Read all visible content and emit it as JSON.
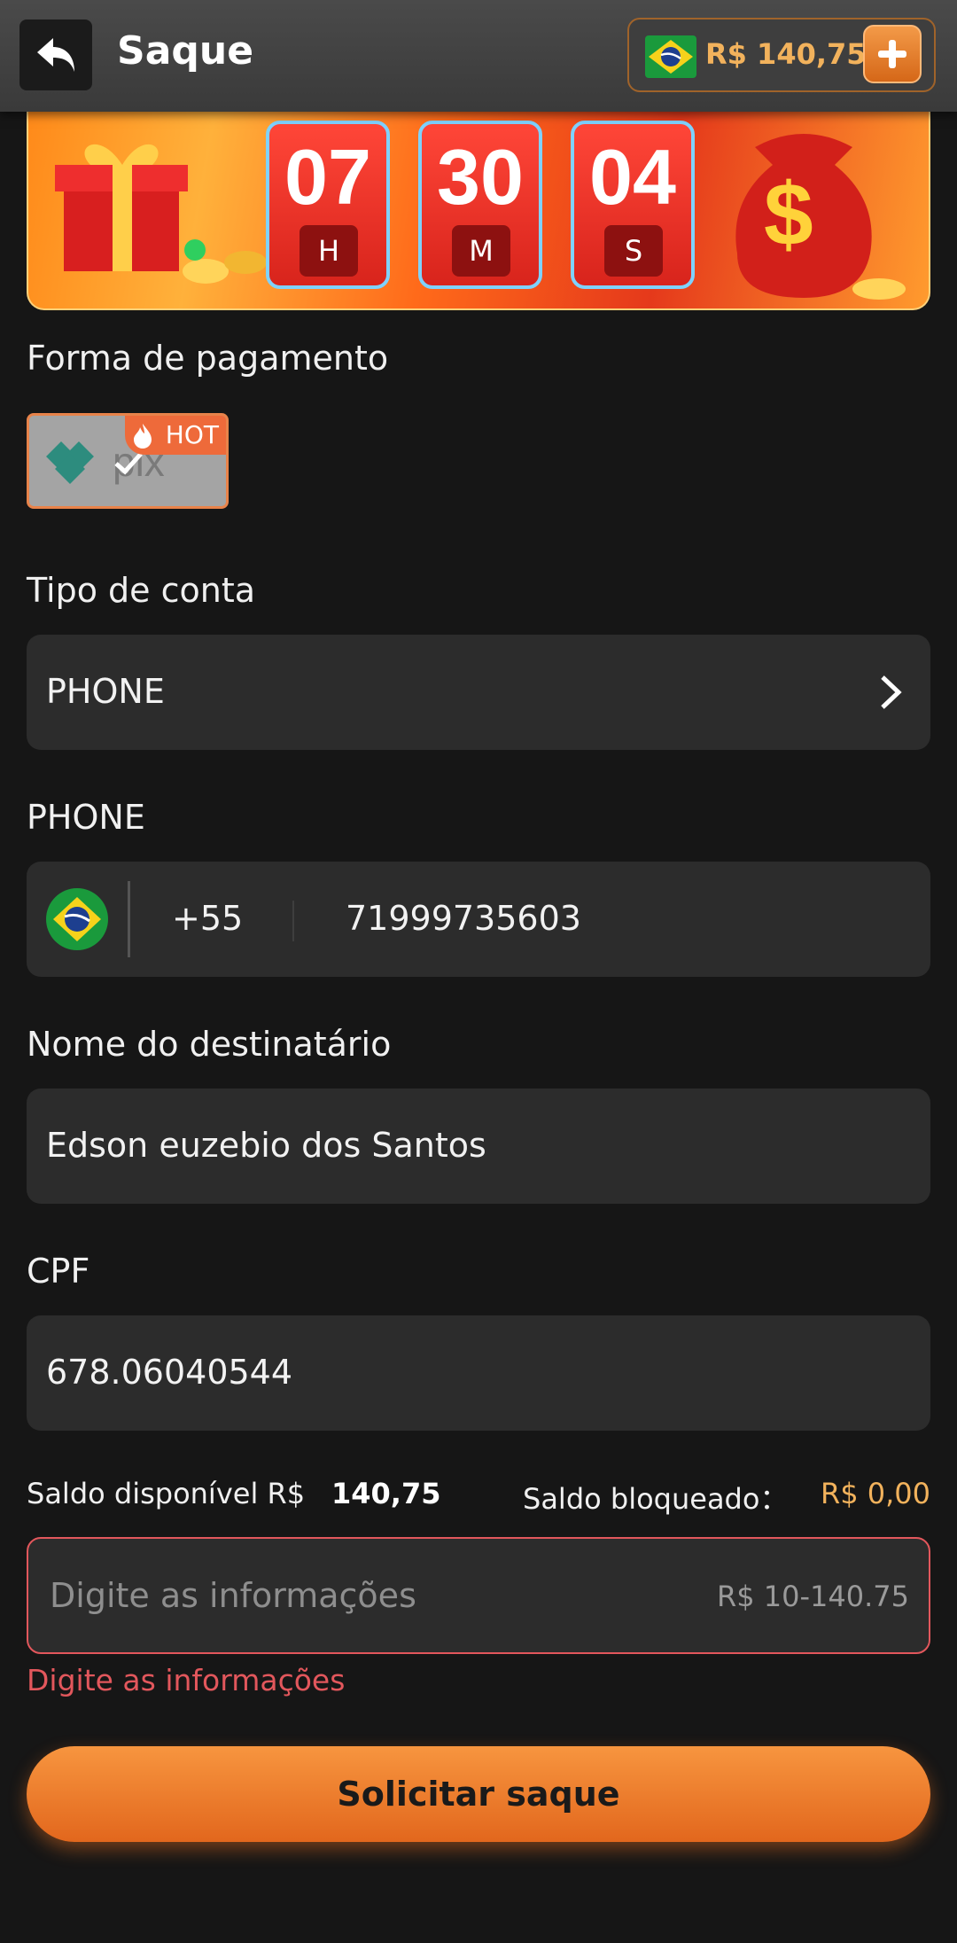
{
  "header": {
    "title": "Saque",
    "balance": "R$ 140,75"
  },
  "timer": {
    "hours": "07",
    "hours_unit": "H",
    "minutes": "30",
    "minutes_unit": "M",
    "seconds": "04",
    "seconds_unit": "S"
  },
  "payment": {
    "label": "Forma de pagamento",
    "method_badge": "HOT",
    "method_name": "pix"
  },
  "account_type": {
    "label": "Tipo de conta",
    "value": "PHONE"
  },
  "phone": {
    "label": "PHONE",
    "country_code": "+55",
    "number": "71999735603"
  },
  "recipient": {
    "label": "Nome do destinatário",
    "value": "Edson euzebio dos Santos"
  },
  "cpf": {
    "label": "CPF",
    "value": "678.06040544"
  },
  "balances": {
    "available_label": "Saldo disponível R$",
    "available_value": "140,75",
    "blocked_label": "Saldo bloqueado：",
    "blocked_value": "R$ 0,00"
  },
  "amount": {
    "placeholder": "Digite as informações",
    "range": "R$ 10-140.75",
    "error": "Digite as informações"
  },
  "submit_label": "Solicitar saque",
  "colors": {
    "accent": "#f0852d",
    "balance_gold": "#f2b25c",
    "error": "#e2575c",
    "background": "#161616"
  }
}
